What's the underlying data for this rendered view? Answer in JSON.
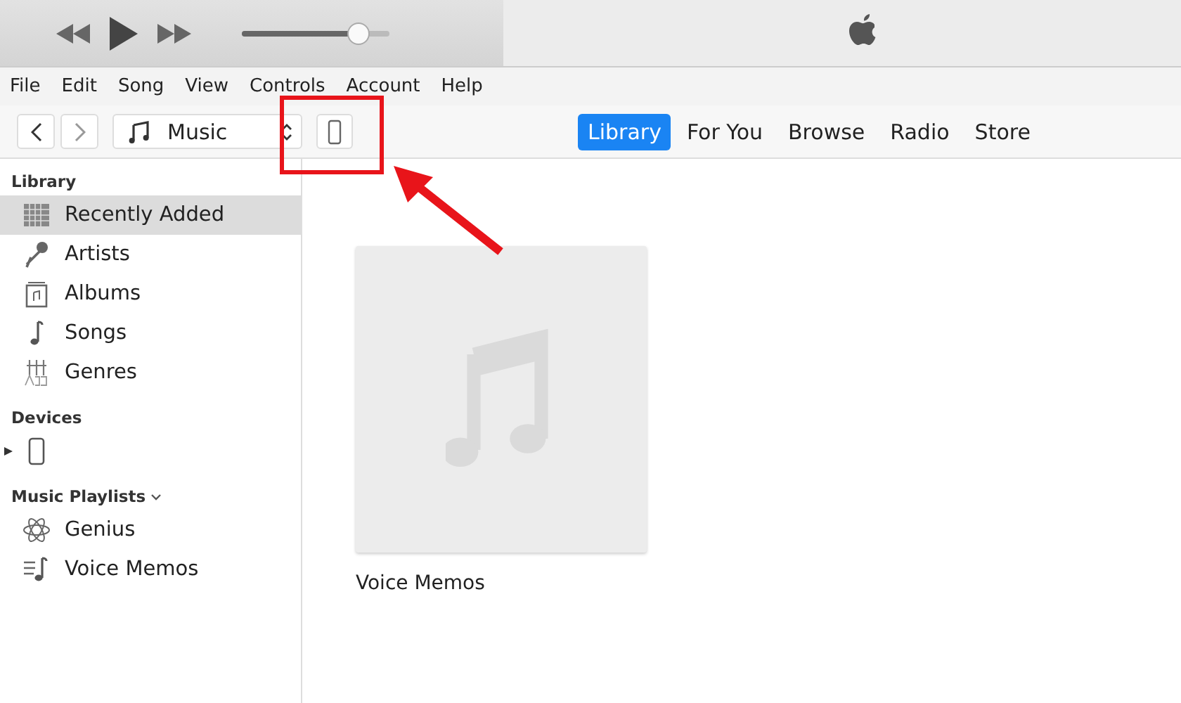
{
  "player": {
    "volume": {
      "level": 0.84
    }
  },
  "menu": [
    "File",
    "Edit",
    "Song",
    "View",
    "Controls",
    "Account",
    "Help"
  ],
  "toolbar": {
    "source": "Music"
  },
  "tabs": [
    {
      "label": "Library",
      "selected": true
    },
    {
      "label": "For You",
      "selected": false
    },
    {
      "label": "Browse",
      "selected": false
    },
    {
      "label": "Radio",
      "selected": false
    },
    {
      "label": "Store",
      "selected": false
    }
  ],
  "sidebar": {
    "sections": [
      {
        "title": "Library",
        "kind": "plain",
        "items": [
          {
            "label": "Recently Added",
            "selected": true
          },
          {
            "label": "Artists",
            "selected": false
          },
          {
            "label": "Albums",
            "selected": false
          },
          {
            "label": "Songs",
            "selected": false
          },
          {
            "label": "Genres",
            "selected": false
          }
        ]
      },
      {
        "title": "Devices",
        "kind": "plain",
        "items": [
          {
            "selected": false,
            "expanded": false
          }
        ]
      },
      {
        "title": "Music Playlists",
        "kind": "dropdown",
        "items": [
          {
            "label": "Genius",
            "selected": false
          },
          {
            "label": "Voice Memos",
            "selected": false
          }
        ]
      }
    ]
  },
  "albums": [
    {
      "title": "Voice Memos"
    }
  ]
}
